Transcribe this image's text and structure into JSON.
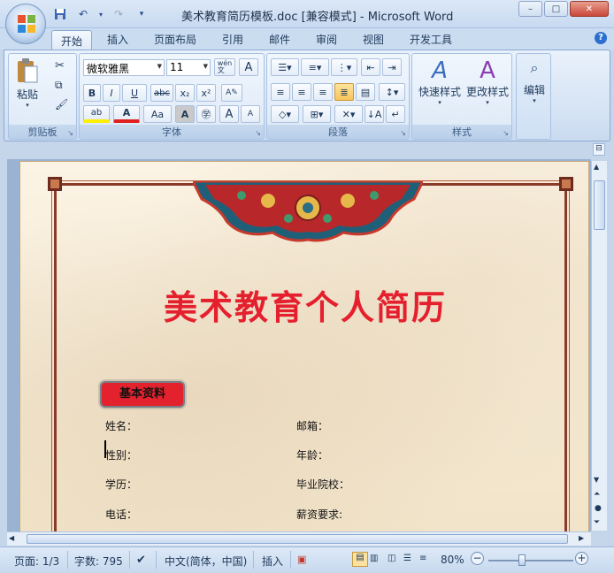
{
  "window": {
    "title": "美术教育简历模板.doc [兼容模式] - Microsoft Word",
    "controls": {
      "minimize": "–",
      "maximize": "□",
      "close": "✕"
    }
  },
  "quick_access": {
    "save": "save-icon",
    "undo": "undo-icon",
    "redo": "redo-icon",
    "customize": "▾"
  },
  "tabs": [
    "开始",
    "插入",
    "页面布局",
    "引用",
    "邮件",
    "审阅",
    "视图",
    "开发工具"
  ],
  "ribbon": {
    "clipboard": {
      "paste": "粘贴",
      "label": "剪贴板"
    },
    "font": {
      "name": "微软雅黑",
      "size": "11",
      "label": "字体",
      "btn_bold": "B",
      "btn_italic": "I",
      "btn_underline": "U",
      "btn_strike": "abc",
      "btn_sub": "x₂",
      "btn_sup": "x²",
      "btn_case": "Aa",
      "btn_grow": "A",
      "btn_shrink": "A",
      "btn_wen": "wén\n文"
    },
    "paragraph": {
      "label": "段落"
    },
    "styles": {
      "quick": "快速样式",
      "change": "更改样式",
      "label": "样式"
    },
    "editing": {
      "label": "编辑"
    }
  },
  "document": {
    "title": "美术教育个人简历",
    "section_badge": "基本资料",
    "fields": {
      "name": "姓名：",
      "email": "邮箱：",
      "gender": "性别：",
      "age": "年龄：",
      "education": "学历：",
      "school": "毕业院校：",
      "phone": "电话：",
      "salary": "薪资要求:"
    }
  },
  "status": {
    "page": "页面: 1/3",
    "words": "字数: 795",
    "language": "中文(简体，中国)",
    "mode": "插入",
    "zoom": "80%"
  },
  "colors": {
    "title_red": "#e5202e",
    "badge_red": "#e3222d",
    "frame_brown": "#8b3a2a"
  }
}
